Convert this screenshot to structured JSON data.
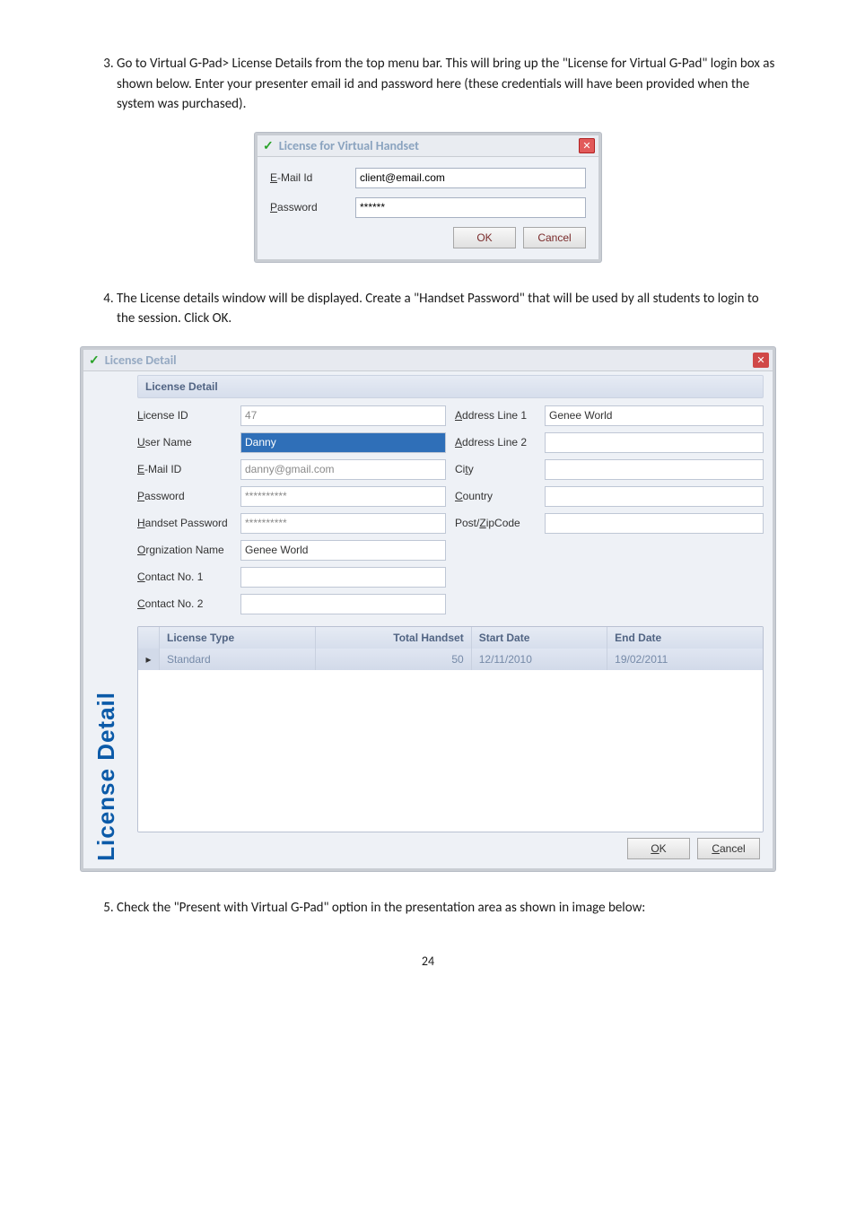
{
  "doc": {
    "item3": "Go to Virtual G-Pad> License Details from the top menu bar.  This will bring up the \"License for Virtual G-Pad\" login box as shown below.  Enter your presenter email id and password here (these credentials will have been provided when the system was purchased).",
    "item4": "The License details window will be displayed.  Create a \"Handset Password\" that will be used by all students to login to the session. Click OK.",
    "item5": "Check the \"Present with Virtual G-Pad\" option in the presentation area as shown in image below:",
    "pageNumber": "24"
  },
  "dlg1": {
    "title": "License for Virtual Handset",
    "emailLabel": "E-Mail Id",
    "emailLabelUL": "E",
    "emailVal": "client@email.com",
    "passLabel": "assword",
    "passLabelUL": "P",
    "passVal": "******",
    "ok": "OK",
    "cancel": "Cancel"
  },
  "dlg2": {
    "title": "License Detail",
    "section": "License Detail",
    "fields": {
      "licenseId": {
        "label": "icense ID",
        "ul": "L",
        "val": "47"
      },
      "userName": {
        "label": "ser Name",
        "ul": "U",
        "val": "Danny"
      },
      "email": {
        "label": "-Mail ID",
        "ul": "E",
        "val": "danny@gmail.com"
      },
      "password": {
        "label": "assword",
        "ul": "P",
        "val": "**********"
      },
      "handsetPw": {
        "label": "andset Password",
        "ul": "H",
        "val": "**********"
      },
      "orgName": {
        "label": "rgnization Name",
        "ul": "O",
        "val": "Genee World"
      },
      "contact1": {
        "label": "ontact No. 1",
        "ul": "C",
        "val": ""
      },
      "contact2": {
        "label": "ontact No. 2",
        "ul": "C",
        "val": ""
      },
      "addr1": {
        "label": "ddress Line 1",
        "ul": "A",
        "val": "Genee World"
      },
      "addr2": {
        "label": "ddress Line 2",
        "ul": "A",
        "val": ""
      },
      "city": {
        "label": "ty",
        "ul": "Ci",
        "val": ""
      },
      "country": {
        "label": "ountry",
        "ul": "C",
        "val": ""
      },
      "zip": {
        "label": "ipCode",
        "ul": "Post/Z",
        "ulPrefix": "",
        "val": ""
      }
    },
    "grid": {
      "headers": {
        "type": "License Type",
        "hand": "Total Handset",
        "start": "Start Date",
        "end": "End Date"
      },
      "row": {
        "type": "Standard",
        "hand": "50",
        "start": "12/11/2010",
        "end": "19/02/2011"
      }
    },
    "sideLabel": "License Detail",
    "ok": "OK",
    "okUL": "O",
    "cancel": "ancel",
    "cancelUL": "C"
  }
}
